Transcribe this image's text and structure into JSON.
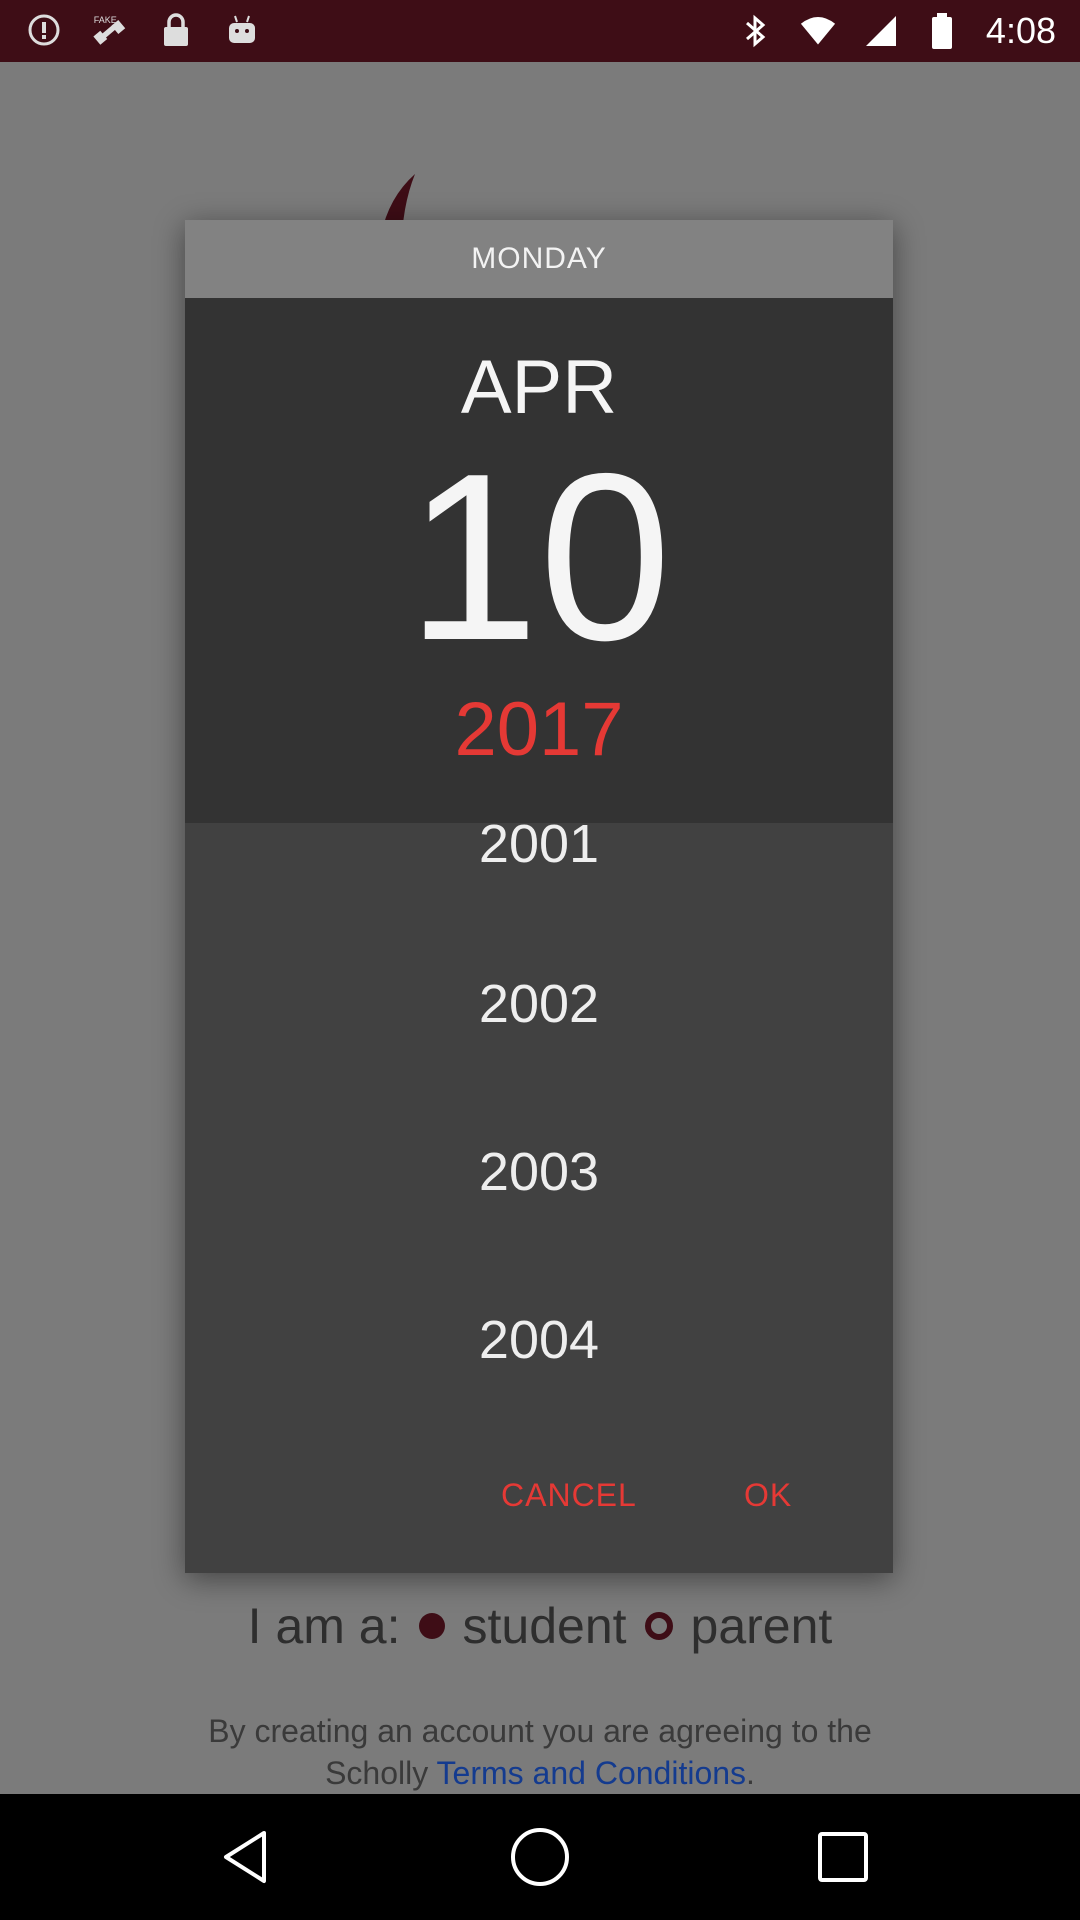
{
  "status_bar": {
    "time": "4:08",
    "left_icons": [
      "alert-circle-icon",
      "fake-gps-icon",
      "lock-icon",
      "android-icon"
    ],
    "right_icons": [
      "bluetooth-icon",
      "wifi-icon",
      "signal-icon",
      "battery-icon"
    ],
    "background": "#3e0d16"
  },
  "dialog": {
    "day_of_week": "MONDAY",
    "month": "APR",
    "day": "10",
    "selected_year": "2017",
    "years": [
      "2001",
      "2002",
      "2003",
      "2004"
    ],
    "cancel_label": "CANCEL",
    "ok_label": "OK",
    "accent_color": "#e53935"
  },
  "background_page": {
    "role_prefix": "I am a:",
    "role_student": "student",
    "role_parent": "parent",
    "terms_text": "By creating an account you are agreeing to the",
    "terms_text_2": "Scholly",
    "terms_link": "Terms and Conditions",
    "terms_end": "."
  },
  "nav_bar": {
    "buttons": [
      "back-icon",
      "home-icon",
      "recent-apps-icon"
    ]
  }
}
